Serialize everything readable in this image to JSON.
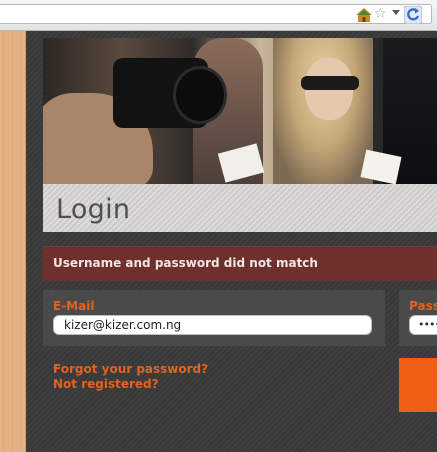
{
  "browser": {
    "icons": [
      "home-icon",
      "star-icon",
      "dropdown-icon",
      "reload-icon"
    ]
  },
  "page": {
    "title": "Login",
    "error_message": "Username and password did not match",
    "email": {
      "label": "E-Mail",
      "value": "kizer@kizer.com.ng"
    },
    "password": {
      "label": "Pass",
      "value": "••••"
    },
    "links": {
      "forgot": "Forgot your password?",
      "register": "Not registered?"
    }
  },
  "colors": {
    "accent": "#e5621f",
    "error_bg": "#6f2f2c",
    "panel_bg": "#4a4a4a",
    "page_bg": "#3a3a3a",
    "button": "#ef5f14"
  }
}
